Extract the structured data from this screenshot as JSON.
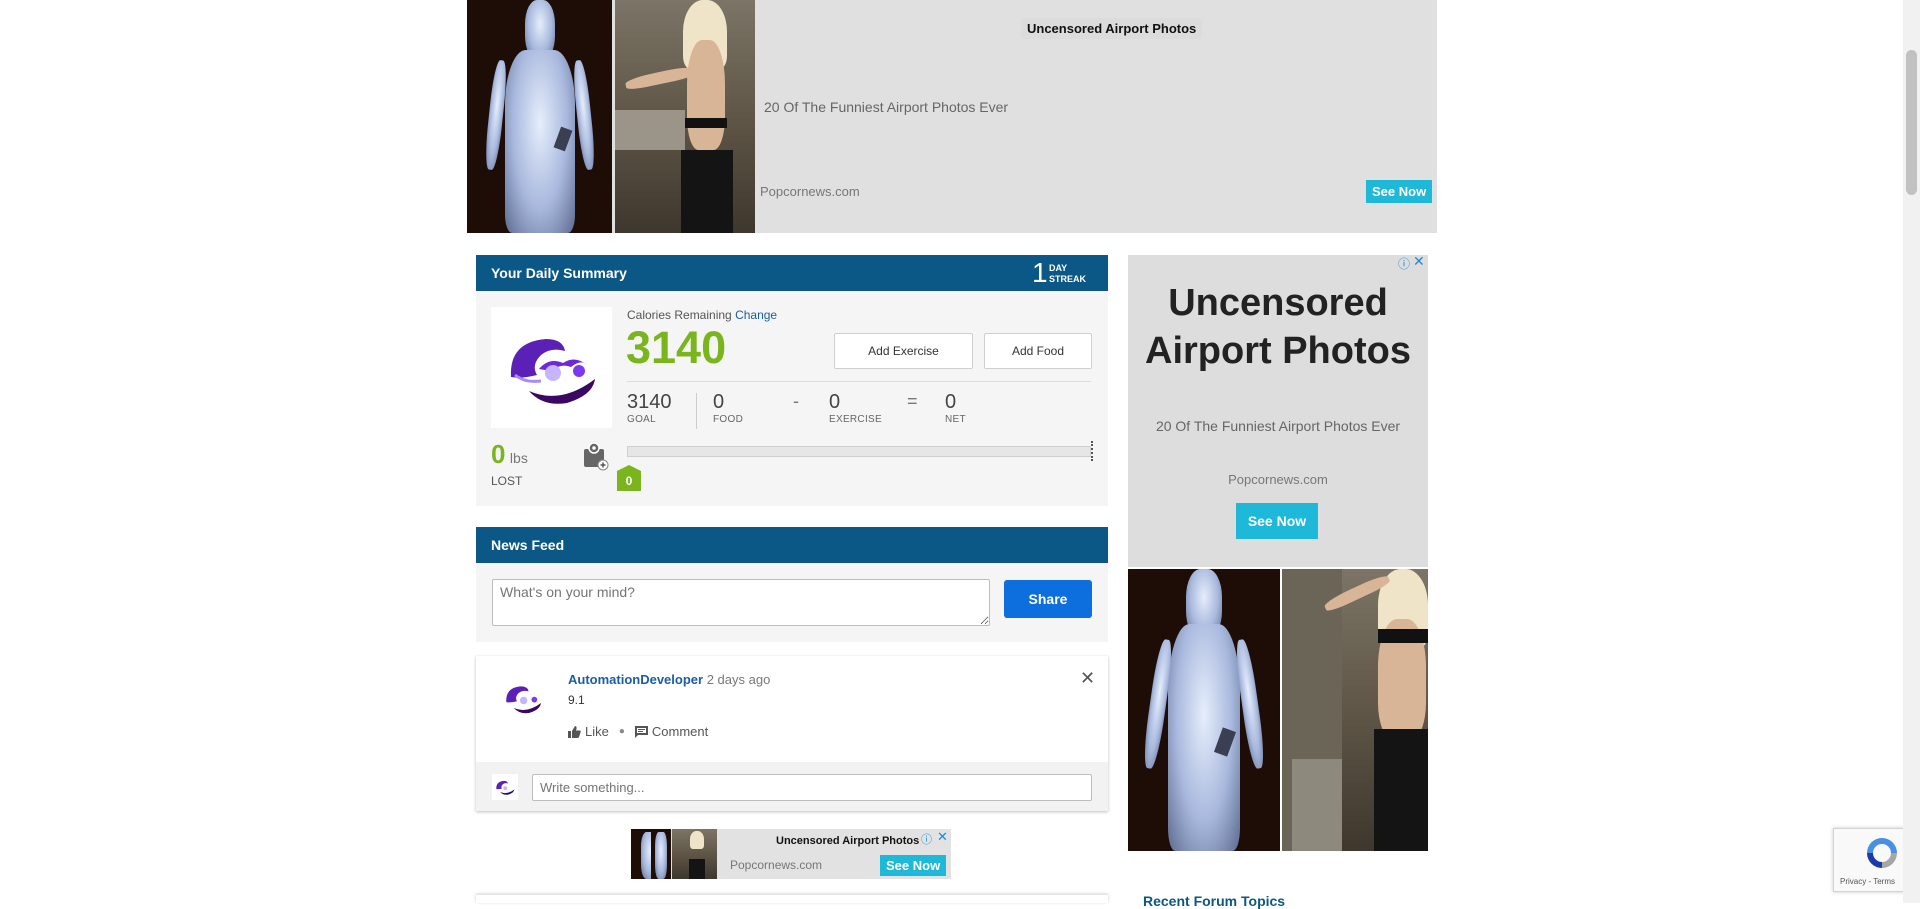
{
  "top_ad": {
    "title": "Uncensored Airport Photos",
    "subtitle": "20 Of The Funniest Airport Photos Ever",
    "source": "Popcornews.com",
    "cta": "See Now"
  },
  "summary": {
    "title": "Your Daily Summary",
    "streak_count": "1",
    "streak_label_1": "DAY",
    "streak_label_2": "STREAK",
    "calories_remaining_label": "Calories Remaining",
    "change_link": "Change",
    "calories_remaining": "3140",
    "add_exercise": "Add Exercise",
    "add_food": "Add Food",
    "stats": {
      "goal": "3140",
      "goal_label": "GOAL",
      "food": "0",
      "food_label": "FOOD",
      "minus": "-",
      "exercise": "0",
      "exercise_label": "EXERCISE",
      "equals": "=",
      "net": "0",
      "net_label": "NET"
    },
    "lost_value": "0",
    "lost_unit": "lbs",
    "lost_label": "LOST",
    "progress_marker": "0",
    "progress_fraction": 0
  },
  "news_feed": {
    "title": "News Feed",
    "placeholder": "What's on your mind?",
    "share": "Share",
    "post": {
      "author": "AutomationDeveloper",
      "time": "2 days ago",
      "body": "9.1",
      "like": "Like",
      "comment": "Comment",
      "comment_placeholder": "Write something..."
    }
  },
  "bottom_ad": {
    "title": "Uncensored Airport Photos",
    "source": "Popcornews.com",
    "cta": "See Now"
  },
  "side_ad": {
    "title_line_1": "Uncensored",
    "title_line_2": "Airport Photos",
    "subtitle": "20 Of The Funniest Airport Photos Ever",
    "source": "Popcornews.com",
    "cta": "See Now"
  },
  "forum": {
    "heading": "Recent Forum Topics"
  },
  "recaptcha": {
    "privacy": "Privacy",
    "sep": "-",
    "terms": "Terms"
  },
  "colors": {
    "header_blue": "#0b5785",
    "calorie_green": "#7ab51d",
    "share_blue": "#0d6ede",
    "ad_cta": "#1eb8d8"
  }
}
